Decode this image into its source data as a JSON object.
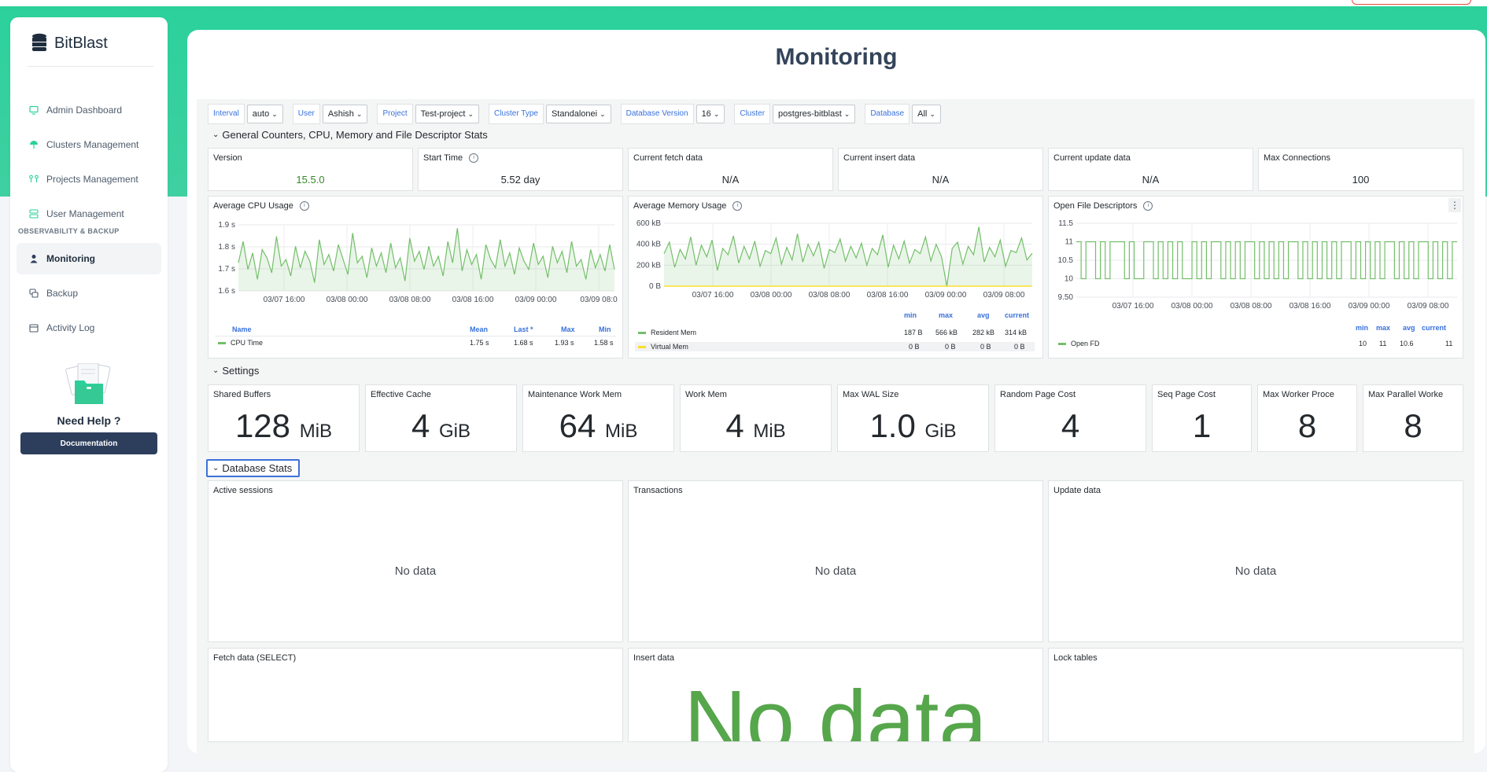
{
  "app": {
    "name": "BitBlast"
  },
  "colors": {
    "accent": "#2bd19b",
    "green": "#73bf69",
    "brandNavy": "#2d3e5c",
    "linkBlue": "#3871dc",
    "yellow": "#fade2a"
  },
  "sidebar": {
    "items": [
      {
        "label": "Admin Dashboard",
        "icon": "monitor-icon"
      },
      {
        "label": "Clusters Management",
        "icon": "umbrella-icon"
      },
      {
        "label": "Projects Management",
        "icon": "flow-icon"
      },
      {
        "label": "User Management",
        "icon": "users-icon"
      }
    ],
    "section_label": "OBSERVABILITY & BACKUP",
    "section_items": [
      {
        "label": "Monitoring",
        "icon": "user-icon",
        "active": true
      },
      {
        "label": "Backup",
        "icon": "backup-icon"
      },
      {
        "label": "Activity Log",
        "icon": "calendar-icon"
      }
    ],
    "help_title": "Need Help ?",
    "doc_button": "Documentation"
  },
  "page": {
    "title": "Monitoring"
  },
  "variables": [
    {
      "label": "Interval",
      "value": "auto"
    },
    {
      "label": "User",
      "value": "Ashish"
    },
    {
      "label": "Project",
      "value": "Test-project"
    },
    {
      "label": "Cluster Type",
      "value": "Standalonei"
    },
    {
      "label": "Database Version",
      "value": "16"
    },
    {
      "label": "Cluster",
      "value": "postgres-bitblast"
    },
    {
      "label": "Database",
      "value": "All"
    }
  ],
  "rows": {
    "general": "General Counters, CPU, Memory and File Descriptor Stats",
    "settings": "Settings",
    "database": "Database Stats"
  },
  "general_stats": [
    {
      "title": "Version",
      "value": "15.5.0",
      "color": "#37872d"
    },
    {
      "title": "Start Time",
      "value": "5.52 day",
      "info": true
    },
    {
      "title": "Current fetch data",
      "value": "N/A"
    },
    {
      "title": "Current insert data",
      "value": "N/A"
    },
    {
      "title": "Current update data",
      "value": "N/A"
    },
    {
      "title": "Max Connections",
      "value": "100"
    }
  ],
  "cpu_panel": {
    "title": "Average CPU Usage",
    "legend_headers": [
      "Name",
      "Mean",
      "Last *",
      "Max",
      "Min"
    ],
    "legend_row": {
      "name": "CPU Time",
      "values": [
        "1.75 s",
        "1.68 s",
        "1.93 s",
        "1.58 s"
      ]
    }
  },
  "mem_panel": {
    "title": "Average Memory Usage",
    "legend_headers": [
      "min",
      "max",
      "avg",
      "current"
    ],
    "legend_rows": [
      {
        "name": "Resident Mem",
        "values": [
          "187 B",
          "566 kB",
          "282 kB",
          "314 kB"
        ],
        "color": "#73bf69"
      },
      {
        "name": "Virtual Mem",
        "values": [
          "0 B",
          "0 B",
          "0 B",
          "0 B"
        ],
        "color": "#fade2a"
      }
    ]
  },
  "fd_panel": {
    "title": "Open File Descriptors",
    "legend_headers": [
      "min",
      "max",
      "avg",
      "current"
    ],
    "legend_row": {
      "name": "Open FD",
      "values": [
        "10",
        "11",
        "10.6",
        "11"
      ]
    }
  },
  "chart_data": [
    {
      "type": "line",
      "title": "Average CPU Usage",
      "y_ticks": [
        "1.9 s",
        "1.8 s",
        "1.7 s",
        "1.6 s"
      ],
      "x_ticks": [
        "03/07 16:00",
        "03/08 00:00",
        "03/08 08:00",
        "03/08 16:00",
        "03/09 00:00",
        "03/09 08:0"
      ],
      "ylim": [
        1.55,
        1.95
      ],
      "series": [
        {
          "name": "CPU Time",
          "values": [
            1.72,
            1.85,
            1.68,
            1.78,
            1.62,
            1.8,
            1.75,
            1.66,
            1.88,
            1.7,
            1.74,
            1.64,
            1.82,
            1.69,
            1.79,
            1.73,
            1.6,
            1.86,
            1.71,
            1.77,
            1.67,
            1.83,
            1.74,
            1.65,
            1.9,
            1.72,
            1.76,
            1.63,
            1.81,
            1.7,
            1.78,
            1.66,
            1.84,
            1.69,
            1.75,
            1.61,
            1.87,
            1.73,
            1.79,
            1.68,
            1.82,
            1.7,
            1.76,
            1.64,
            1.85,
            1.72,
            1.93,
            1.67,
            1.8,
            1.71,
            1.77,
            1.62,
            1.83,
            1.74,
            1.69,
            1.86,
            1.7,
            1.78,
            1.65,
            1.81,
            1.73,
            1.68,
            1.84,
            1.71,
            1.76,
            1.63,
            1.82,
            1.72,
            1.79,
            1.66,
            1.85,
            1.7,
            1.74,
            1.62,
            1.8,
            1.69,
            1.77,
            1.67,
            1.83,
            1.68
          ]
        }
      ]
    },
    {
      "type": "area",
      "title": "Average Memory Usage",
      "y_ticks": [
        "600 kB",
        "400 kB",
        "200 kB",
        "0 B"
      ],
      "x_ticks": [
        "03/07 16:00",
        "03/08 00:00",
        "03/08 08:00",
        "03/08 16:00",
        "03/09 00:00",
        "03/09 08:00"
      ],
      "ylim": [
        0,
        600
      ],
      "series": [
        {
          "name": "Resident Mem",
          "values": [
            310,
            420,
            180,
            350,
            260,
            470,
            200,
            390,
            280,
            440,
            150,
            360,
            300,
            480,
            220,
            380,
            260,
            430,
            190,
            340,
            310,
            460,
            210,
            370,
            250,
            500,
            230,
            400,
            290,
            420,
            170,
            350,
            320,
            450,
            240,
            380,
            270,
            410,
            200,
            360,
            300,
            490,
            180,
            390,
            260,
            430,
            220,
            350,
            310,
            470,
            240,
            400,
            280,
            0,
            360,
            420,
            210,
            380,
            300,
            566,
            230,
            370,
            280,
            440,
            190,
            340,
            320,
            460,
            250,
            314
          ]
        },
        {
          "name": "Virtual Mem",
          "values": [
            0,
            0,
            0,
            0,
            0,
            0,
            0,
            0,
            0,
            0
          ]
        }
      ]
    },
    {
      "type": "line",
      "title": "Open File Descriptors",
      "y_ticks": [
        "11.5",
        "11",
        "10.5",
        "10",
        "9.50"
      ],
      "x_ticks": [
        "03/07 16:00",
        "03/08 00:00",
        "03/08 08:00",
        "03/08 16:00",
        "03/09 00:00",
        "03/09 08:00"
      ],
      "ylim": [
        9.5,
        11.5
      ],
      "series": [
        {
          "name": "Open FD",
          "values": [
            11,
            10,
            11,
            11,
            10,
            11,
            10,
            11,
            11,
            11,
            10,
            11,
            10,
            10,
            11,
            11,
            10,
            11,
            10,
            11,
            10,
            11,
            10,
            10,
            11,
            10,
            11,
            10,
            11,
            11,
            10,
            11,
            10,
            11,
            10,
            11,
            11,
            10,
            11,
            10,
            11,
            10,
            11,
            10,
            11,
            11,
            10,
            11,
            10,
            11,
            10,
            11,
            10,
            11,
            10,
            11,
            11,
            10,
            11,
            10,
            11,
            10,
            11,
            10,
            11,
            11,
            10,
            11,
            10,
            11,
            10,
            11,
            11,
            10,
            11,
            10,
            11,
            10,
            11,
            11
          ]
        }
      ]
    }
  ],
  "settings_stats": [
    {
      "title": "Shared Buffers",
      "value": "128",
      "unit": "MiB"
    },
    {
      "title": "Effective Cache",
      "value": "4",
      "unit": "GiB"
    },
    {
      "title": "Maintenance Work Mem",
      "value": "64",
      "unit": "MiB"
    },
    {
      "title": "Work Mem",
      "value": "4",
      "unit": "MiB"
    },
    {
      "title": "Max WAL Size",
      "value": "1.0",
      "unit": "GiB"
    },
    {
      "title": "Random Page Cost",
      "value": "4",
      "unit": ""
    },
    {
      "title": "Seq Page Cost",
      "value": "1",
      "unit": ""
    },
    {
      "title": "Max Worker Proce",
      "value": "8",
      "unit": ""
    },
    {
      "title": "Max Parallel Worke",
      "value": "8",
      "unit": ""
    }
  ],
  "db_panels": [
    {
      "title": "Active sessions",
      "no_data": "No data"
    },
    {
      "title": "Transactions",
      "no_data": "No data"
    },
    {
      "title": "Update data",
      "no_data": "No data"
    },
    {
      "title": "Fetch data (SELECT)"
    },
    {
      "title": "Insert data",
      "big_no_data": "No data"
    },
    {
      "title": "Lock tables"
    }
  ]
}
